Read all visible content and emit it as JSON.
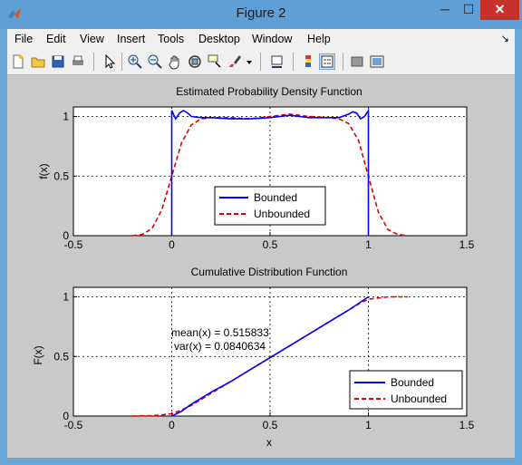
{
  "window": {
    "title": "Figure 2",
    "minimize_glyph": "─",
    "maximize_glyph": "☐",
    "close_glyph": "✕"
  },
  "menu": {
    "items": [
      "File",
      "Edit",
      "View",
      "Insert",
      "Tools",
      "Desktop",
      "Window",
      "Help"
    ],
    "dock_glyph": "↘"
  },
  "toolbar": {
    "icons": [
      "new-figure-icon",
      "open-file-icon",
      "save-icon",
      "print-icon",
      "arrow-cursor-icon",
      "zoom-in-icon",
      "zoom-out-icon",
      "pan-hand-icon",
      "rotate-3d-icon",
      "data-cursor-icon",
      "brush-icon",
      "brush-dropdown-icon",
      "link-plot-icon",
      "colorbar-icon",
      "legend-icon",
      "hide-plot-tools-icon",
      "show-plot-tools-icon"
    ]
  },
  "colors": {
    "bounded": "#0000ff",
    "unbounded": "#e00000"
  },
  "chart_data": [
    {
      "type": "line",
      "title": "Estimated Probability Density Function",
      "xlabel": "",
      "ylabel": "f(x)",
      "xlim": [
        -0.5,
        1.5
      ],
      "ylim": [
        0,
        1.08
      ],
      "xticks": [
        "-0.5",
        "0",
        "0.5",
        "1",
        "1.5"
      ],
      "yticks": [
        "0",
        "0.5",
        "1"
      ],
      "grid": "dotted",
      "legend": "bottom-center",
      "series": [
        {
          "name": "Bounded",
          "style": "solid",
          "x": [
            0,
            0,
            0.02,
            0.04,
            0.06,
            0.08,
            0.1,
            0.15,
            0.2,
            0.3,
            0.4,
            0.5,
            0.55,
            0.6,
            0.65,
            0.7,
            0.8,
            0.85,
            0.9,
            0.92,
            0.94,
            0.96,
            0.98,
            1,
            1
          ],
          "y": [
            0,
            1.05,
            0.98,
            1.03,
            1.05,
            1.03,
            1.0,
            0.99,
            0.99,
            0.98,
            0.98,
            0.99,
            1.0,
            1.01,
            1.0,
            0.99,
            0.99,
            0.99,
            1.02,
            1.04,
            1.03,
            0.98,
            1.0,
            1.05,
            0
          ]
        },
        {
          "name": "Unbounded",
          "style": "dashed",
          "x": [
            -0.2,
            -0.15,
            -0.1,
            -0.05,
            0,
            0.05,
            0.1,
            0.15,
            0.2,
            0.3,
            0.4,
            0.5,
            0.6,
            0.7,
            0.8,
            0.85,
            0.9,
            0.95,
            1,
            1.05,
            1.1,
            1.15,
            1.2
          ],
          "y": [
            0,
            0.01,
            0.06,
            0.22,
            0.5,
            0.78,
            0.93,
            0.98,
            0.99,
            0.99,
            0.98,
            1.0,
            1.02,
            1.0,
            0.99,
            0.98,
            0.94,
            0.8,
            0.5,
            0.2,
            0.05,
            0.01,
            0
          ]
        }
      ]
    },
    {
      "type": "line",
      "title": "Cumulative Distribution Function",
      "xlabel": "x",
      "ylabel": "F(x)",
      "xlim": [
        -0.5,
        1.5
      ],
      "ylim": [
        0,
        1.08
      ],
      "xticks": [
        "-0.5",
        "0",
        "0.5",
        "1",
        "1.5"
      ],
      "yticks": [
        "0",
        "0.5",
        "1"
      ],
      "grid": "dotted",
      "legend": "bottom-right",
      "annotations": [
        "mean(x) = 0.515833",
        "var(x) = 0.0840634"
      ],
      "series": [
        {
          "name": "Bounded",
          "style": "solid",
          "x": [
            0,
            0.05,
            0.1,
            0.2,
            0.3,
            0.4,
            0.5,
            0.6,
            0.7,
            0.8,
            0.9,
            1
          ],
          "y": [
            0,
            0.04,
            0.1,
            0.2,
            0.29,
            0.39,
            0.49,
            0.59,
            0.69,
            0.79,
            0.89,
            1.0
          ]
        },
        {
          "name": "Unbounded",
          "style": "dashed",
          "x": [
            -0.2,
            -0.1,
            -0.05,
            0,
            0.05,
            0.1,
            0.2,
            0.3,
            0.4,
            0.5,
            0.6,
            0.7,
            0.8,
            0.9,
            0.95,
            1,
            1.05,
            1.1,
            1.2
          ],
          "y": [
            0,
            0.003,
            0.01,
            0.02,
            0.05,
            0.09,
            0.19,
            0.29,
            0.39,
            0.49,
            0.59,
            0.69,
            0.79,
            0.89,
            0.94,
            0.98,
            0.99,
            1.0,
            1.0
          ]
        }
      ]
    }
  ]
}
